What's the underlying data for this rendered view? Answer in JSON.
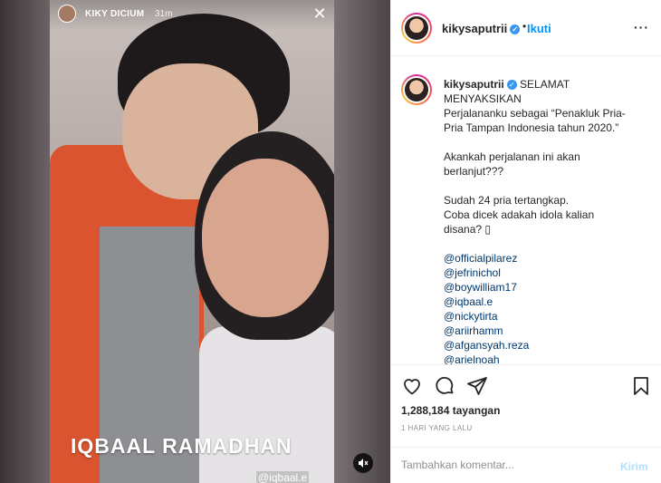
{
  "story": {
    "username": "KIKY DICIUM",
    "time": "31m",
    "close_glyph": "✕",
    "caption": "IQBAAL RAMADHAN",
    "tag": "@iqbaal.e",
    "mute_icon": "speaker-muted-icon"
  },
  "header": {
    "username": "kikysaputrii",
    "follow_label": "Ikuti",
    "more_glyph": "···"
  },
  "caption": {
    "username": "kikysaputrii",
    "lines1": [
      "SELAMAT",
      "MENYAKSIKAN",
      "Perjalananku sebagai “Penakluk Pria-",
      "Pria Tampan Indonesia tahun 2020.”"
    ],
    "lines2": [
      "Akankah perjalanan ini akan",
      "berlanjut???"
    ],
    "lines3": [
      "Sudah 24 pria tertangkap.",
      "Coba dicek adakah idola kalian",
      "disana? ▯"
    ],
    "mentions": [
      "@officialpilarez",
      "@jefrinichol",
      "@boywilliam17",
      "@iqbaal.e",
      "@nickytirta",
      "@ariirhamm",
      "@afgansyah.reza",
      "@arielnoah"
    ]
  },
  "stats": {
    "views": "1,288,184 tayangan",
    "date": "1 HARI YANG LALU"
  },
  "comment": {
    "placeholder": "Tambahkan komentar...",
    "post_label": "Kirim"
  },
  "colors": {
    "accent": "#0095f6",
    "verified": "#3897f0",
    "mention": "#00376b"
  }
}
